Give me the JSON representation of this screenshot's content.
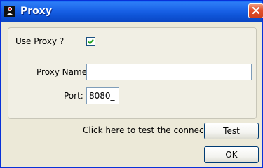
{
  "window": {
    "title": "Proxy",
    "app_icon": "java-duke-icon",
    "close_icon": "close-icon"
  },
  "proxy": {
    "use_proxy_label": "Use Proxy ?",
    "use_proxy_checked": true,
    "proxy_name_label": "Proxy Name:",
    "proxy_name_value": "",
    "port_label": "Port:",
    "port_value": "8080_"
  },
  "actions": {
    "test_hint": "Click here to test the connection:",
    "test_button": "Test",
    "ok_button": "OK"
  },
  "colors": {
    "titlebar": "#0a5ff3",
    "dialog_bg": "#ece9d8",
    "close_button": "#e4502b",
    "checkmark": "#21a121"
  }
}
